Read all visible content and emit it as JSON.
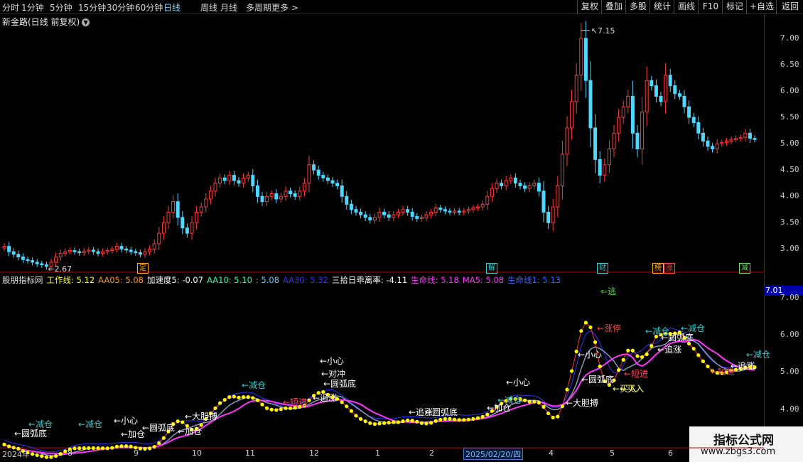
{
  "toolbar": {
    "timeframes": [
      "分时",
      "1分钟",
      "5分钟",
      "15分钟",
      "30分钟",
      "60分钟",
      "日线",
      "周线",
      "月线",
      "多周期",
      "更多 >"
    ],
    "active_timeframe": "日线",
    "right_buttons": [
      "复权",
      "叠加",
      "多股",
      "统计",
      "画线",
      "F10",
      "标记",
      "+自选",
      "返回"
    ]
  },
  "main_chart": {
    "title": "新金路(日线 前复权)",
    "y_ticks": [
      "7.00",
      "6.50",
      "6.00",
      "5.50",
      "5.00",
      "4.50",
      "4.00",
      "3.50",
      "3.00"
    ],
    "high_label": "7.15",
    "low_label": "2.67",
    "event_markers": [
      {
        "text": "定",
        "color": "#ffb000"
      },
      {
        "text": "解",
        "color": "#33cccc"
      },
      {
        "text": "财",
        "color": "#33cccc"
      },
      {
        "text": "榜",
        "color": "#ffb000"
      },
      {
        "text": "涨",
        "color": "#ff4444"
      },
      {
        "text": "减",
        "color": "#66dd66"
      }
    ]
  },
  "indicator_panel": {
    "title": "股朋指标网",
    "values": [
      {
        "label": "工作线:",
        "value": "5.12",
        "color": "#ffff00"
      },
      {
        "label": "AA05:",
        "value": "5.08",
        "color": "#ff9900"
      },
      {
        "label": "加速度5:",
        "value": "-0.07",
        "color": "#ffffff"
      },
      {
        "label": "AA10:",
        "value": "5.10",
        "color": "#33ff99"
      },
      {
        "label": ":",
        "value": "5.08",
        "color": "#66ccff"
      },
      {
        "label": "AA30:",
        "value": "5.32",
        "color": "#3333ff"
      },
      {
        "label": "三拾日乖离率:",
        "value": "-4.11",
        "color": "#ffffff"
      },
      {
        "label": "生命线:",
        "value": "5.18",
        "color": "#ff33ff"
      },
      {
        "label": "MA5:",
        "value": "5.08",
        "color": "#ff33ff"
      },
      {
        "label": "生命线1:",
        "value": "5.13",
        "color": "#3366ff"
      }
    ],
    "y_ticks": [
      "7.00",
      "6.00",
      "5.00",
      "4.00"
    ],
    "current_value": "7.01",
    "signals": [
      {
        "text": "⇐逃",
        "color": "#33dd33"
      },
      {
        "text": "←涨停",
        "color": "#ff4444"
      },
      {
        "text": "←减仓",
        "color": "#33cccc"
      },
      {
        "text": "←减仓",
        "color": "#33cccc"
      },
      {
        "text": "←买入",
        "color": "#ffff66"
      },
      {
        "text": "←短进",
        "color": "#ff4466"
      },
      {
        "text": "←追涨",
        "color": "#ffffff"
      },
      {
        "text": "←短进",
        "color": "#ff4466"
      },
      {
        "text": "←追涨",
        "color": "#ffffff"
      },
      {
        "text": "←减仓",
        "color": "#33cccc"
      },
      {
        "text": "←圆弧底",
        "color": "#ffffff"
      },
      {
        "text": "←圆弧底",
        "color": "#ffffff"
      },
      {
        "text": "←大胆搏",
        "color": "#ffffff"
      },
      {
        "text": "←小心",
        "color": "#ffffff"
      },
      {
        "text": "←小心",
        "color": "#ffffff"
      },
      {
        "text": "←对冲",
        "color": "#ffffff"
      },
      {
        "text": "←减仓",
        "color": "#33cccc"
      },
      {
        "text": "←圆弧底",
        "color": "#ffffff"
      },
      {
        "text": "←追涨",
        "color": "#ffffff"
      },
      {
        "text": "←短进",
        "color": "#ff4466"
      },
      {
        "text": "←追涨",
        "color": "#ffffff"
      },
      {
        "text": "←圆弧底",
        "color": "#ffffff"
      },
      {
        "text": "←加仓",
        "color": "#ffffff"
      },
      {
        "text": "←减仓",
        "color": "#33cccc"
      },
      {
        "text": "←小心",
        "color": "#ffffff"
      },
      {
        "text": "←大胆搏",
        "color": "#ffffff"
      },
      {
        "text": "←加仓",
        "color": "#ffffff"
      },
      {
        "text": "←圆弧底",
        "color": "#ffffff"
      },
      {
        "text": "←小心",
        "color": "#ffffff"
      },
      {
        "text": "←减仓",
        "color": "#33cccc"
      },
      {
        "text": "←圆弧底",
        "color": "#ffffff"
      },
      {
        "text": "←加仓",
        "color": "#ffffff"
      },
      {
        "text": "←减仓",
        "color": "#33cccc"
      },
      {
        "text": "←买入",
        "color": "#ffff66"
      }
    ]
  },
  "x_axis": {
    "labels": [
      "2024年",
      "8",
      "9",
      "10",
      "11",
      "12",
      "1",
      "2",
      "4",
      "5",
      "6"
    ],
    "cursor_date": "2025/02/20/四"
  },
  "watermark": {
    "line1": "指标公式网",
    "line2": "www.zbgs3.com"
  },
  "colors": {
    "up": "#ff3b3b",
    "down": "#4fd8ff",
    "axis": "#b00000",
    "work_line": "#ffff00",
    "life_line": "#ff33ff",
    "aa30": "#3333ff"
  },
  "chart_data": {
    "type": "candlestick",
    "ylim": [
      2.6,
      7.35
    ],
    "closes": [
      3.05,
      2.95,
      2.9,
      2.85,
      2.8,
      2.78,
      2.75,
      2.72,
      2.7,
      2.67,
      2.75,
      2.85,
      2.92,
      2.95,
      2.97,
      2.95,
      2.93,
      2.96,
      2.98,
      2.95,
      2.92,
      2.95,
      2.97,
      3.0,
      3.05,
      3.0,
      2.98,
      2.95,
      2.93,
      2.9,
      2.95,
      3.0,
      3.1,
      3.3,
      3.5,
      3.7,
      3.9,
      3.6,
      3.4,
      3.3,
      3.5,
      3.7,
      3.8,
      3.95,
      4.1,
      4.25,
      4.35,
      4.3,
      4.4,
      4.3,
      4.25,
      4.35,
      4.4,
      4.2,
      4.0,
      3.9,
      4.0,
      4.05,
      3.95,
      4.0,
      4.1,
      4.05,
      4.0,
      4.1,
      4.25,
      4.6,
      4.5,
      4.4,
      4.35,
      4.3,
      4.25,
      4.2,
      4.0,
      3.85,
      3.75,
      3.7,
      3.65,
      3.6,
      3.55,
      3.6,
      3.7,
      3.65,
      3.6,
      3.65,
      3.7,
      3.75,
      3.7,
      3.62,
      3.58,
      3.6,
      3.65,
      3.7,
      3.78,
      3.75,
      3.72,
      3.7,
      3.72,
      3.7,
      3.72,
      3.75,
      3.78,
      3.8,
      3.85,
      4.0,
      4.15,
      4.25,
      4.2,
      4.3,
      4.35,
      4.25,
      4.2,
      4.15,
      4.2,
      4.25,
      4.1,
      3.7,
      3.5,
      3.8,
      4.2,
      4.8,
      5.3,
      5.8,
      6.3,
      7.0,
      6.2,
      5.3,
      4.7,
      4.4,
      4.6,
      4.9,
      5.2,
      5.5,
      5.7,
      5.9,
      5.2,
      4.9,
      5.6,
      6.2,
      6.1,
      5.9,
      5.8,
      6.3,
      6.1,
      5.95,
      5.9,
      5.7,
      5.5,
      5.4,
      5.2,
      5.05,
      4.95,
      4.9,
      5.0,
      5.02,
      5.05,
      5.08,
      5.1,
      5.12,
      5.2,
      5.1,
      5.08
    ]
  }
}
